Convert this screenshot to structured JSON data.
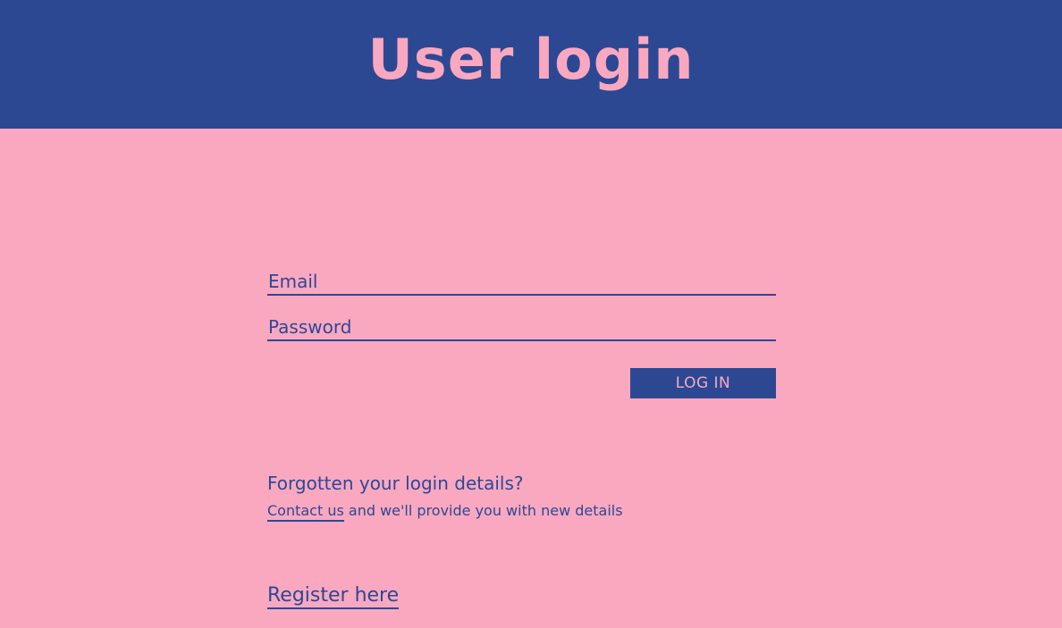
{
  "header": {
    "title": "User login"
  },
  "form": {
    "email_placeholder": "Email",
    "password_placeholder": "Password",
    "email_value": "",
    "password_value": "",
    "login_label": "LOG IN"
  },
  "help": {
    "title": "Forgotten your login details?",
    "contact_link": "Contact us",
    "contact_suffix": " and we'll provide you with new details"
  },
  "register": {
    "label": "Register here"
  },
  "colors": {
    "primary": "#2d4893",
    "background": "#f9a8c0"
  }
}
